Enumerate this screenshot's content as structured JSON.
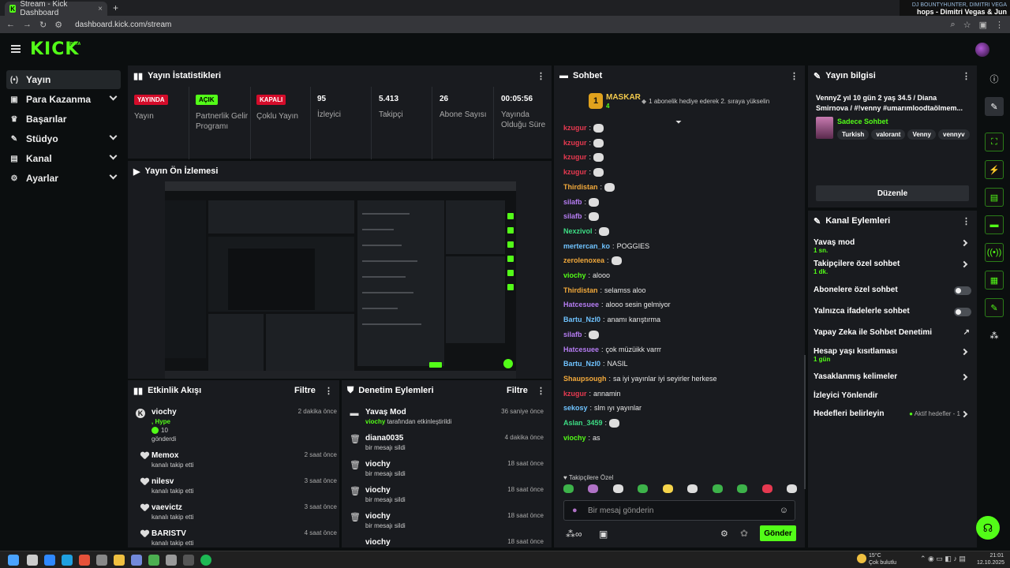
{
  "browser": {
    "tab_title": "Stream - Kick Dashboard",
    "new_tab": "+",
    "url": "dashboard.kick.com/stream",
    "media_title": "DJ BOUNTYHUNTER, DIMITRI VEGA",
    "media_song": "hops - Dimitri Vegas & Jun"
  },
  "app": {
    "logo": "KICK",
    "beta": "BETA"
  },
  "sidebar": {
    "items": [
      {
        "label": "Yayın",
        "icon": "(•)"
      },
      {
        "label": "Para Kazanma",
        "icon": "▣"
      },
      {
        "label": "Başarılar",
        "icon": "♛"
      },
      {
        "label": "Stüdyo",
        "icon": "✎"
      },
      {
        "label": "Kanal",
        "icon": "▤"
      },
      {
        "label": "Ayarlar",
        "icon": "⚙"
      }
    ]
  },
  "stats": {
    "title": "Yayın İstatistikleri",
    "cols": [
      {
        "badge": "YAYINDA",
        "label": "Yayın"
      },
      {
        "badge": "AÇIK",
        "label": "Partnerlik Gelir Programı"
      },
      {
        "badge": "KAPALI",
        "label": "Çoklu Yayın"
      },
      {
        "value": "95",
        "label": "İzleyici"
      },
      {
        "value": "5.413",
        "label": "Takipçi"
      },
      {
        "value": "26",
        "label": "Abone Sayısı"
      },
      {
        "value": "00:05:56",
        "label": "Yayında Olduğu Süre"
      }
    ]
  },
  "preview": {
    "title": "Yayın Ön İzlemesi"
  },
  "activity": {
    "title": "Etkinlik Akışı",
    "filter": "Filtre",
    "rows": [
      {
        "name": "viochy",
        "time": "2 dakika önce",
        "line1": ", Hype",
        "line2": "10",
        "line3": "gönderdi"
      },
      {
        "name": "Memox",
        "sub": "kanalı takip etti",
        "time": "2 saat önce"
      },
      {
        "name": "nilesv",
        "sub": "kanalı takip etti",
        "time": "3 saat önce"
      },
      {
        "name": "vaevictz",
        "sub": "kanalı takip etti",
        "time": "3 saat önce"
      },
      {
        "name": "BARISTV",
        "sub": "kanalı takip etti",
        "time": "4 saat önce"
      }
    ]
  },
  "moderation": {
    "title": "Denetim Eylemleri",
    "filter": "Filtre",
    "rows": [
      {
        "name": "Yavaş Mod",
        "user": "viochy",
        "sub": "tarafından etkinleştirildi",
        "time": "36 saniye önce"
      },
      {
        "name": "diana0035",
        "sub": "bir mesajı sildi",
        "time": "4 dakika önce"
      },
      {
        "name": "viochy",
        "sub": "bir mesajı sildi",
        "time": "18 saat önce"
      },
      {
        "name": "viochy",
        "sub": "bir mesajı sildi",
        "time": "18 saat önce"
      },
      {
        "name": "viochy",
        "sub": "bir mesajı sildi",
        "time": "18 saat önce"
      },
      {
        "name": "viochy",
        "sub": "",
        "time": "18 saat önce"
      }
    ]
  },
  "chat": {
    "title": "Sohbet",
    "pinned_user": "MASKAR",
    "pinned_rank": "1",
    "pinned_count": "4",
    "pinned_text": "1 abonelik hediye ederek 2. sıraya yükselin",
    "messages": [
      {
        "user": "kzugur",
        "color": "#e63950",
        "text": ""
      },
      {
        "user": "kzugur",
        "color": "#e63950",
        "text": ""
      },
      {
        "user": "kzugur",
        "color": "#e63950",
        "text": ""
      },
      {
        "user": "kzugur",
        "color": "#e63950",
        "text": ""
      },
      {
        "user": "Thirdistan",
        "color": "#f2a93b",
        "text": ""
      },
      {
        "user": "silafb",
        "color": "#b57cf2",
        "text": ""
      },
      {
        "user": "silafb",
        "color": "#b57cf2",
        "text": ""
      },
      {
        "user": "Nexzivol",
        "color": "#3ddc84",
        "text": ""
      },
      {
        "user": "mertercan_ko",
        "color": "#6fc3ff",
        "text": "POGGIES"
      },
      {
        "user": "zerolenoxea",
        "color": "#f2a93b",
        "text": ""
      },
      {
        "user": "viochy",
        "color": "#53fc18",
        "text": "alooo"
      },
      {
        "user": "Thirdistan",
        "color": "#f2a93b",
        "text": "selamss aloo"
      },
      {
        "user": "Hatcesuee",
        "color": "#b57cf2",
        "text": "alooo sesin gelmiyor"
      },
      {
        "user": "Bartu_NzI0",
        "color": "#6fc3ff",
        "text": "anamı karıştırma"
      },
      {
        "user": "silafb",
        "color": "#b57cf2",
        "text": ""
      },
      {
        "user": "Hatcesuee",
        "color": "#b57cf2",
        "text": "çok müzüikk varrr"
      },
      {
        "user": "Bartu_NzI0",
        "color": "#6fc3ff",
        "text": "NASIL"
      },
      {
        "user": "Shaupsough",
        "color": "#f2a93b",
        "text": "sa iyi yayınlar iyi seyirler herkese"
      },
      {
        "user": "kzugur",
        "color": "#e63950",
        "text": "annamin"
      },
      {
        "user": "sekosy",
        "color": "#6fc3ff",
        "text": "slm ıyı yayınlar"
      },
      {
        "user": "Aslan_3459",
        "color": "#3ddc84",
        "text": ""
      },
      {
        "user": "viochy",
        "color": "#53fc18",
        "text": "as"
      }
    ],
    "emote_bar_label": "Takipçilere Özel",
    "input_placeholder": "Bir mesaj gönderin",
    "send": "Gönder"
  },
  "stream_info": {
    "title": "Yayın bilgisi",
    "text": "VennyZ yıl 10 gün 2 yaş 34.5 / Diana Smirnova / #!venny #umarımloodtaölmem...",
    "category": "Sadece Sohbet",
    "tags": [
      "Turkish",
      "valorant",
      "Venny",
      "vennyv"
    ],
    "edit": "Düzenle"
  },
  "channel_actions": {
    "title": "Kanal Eylemleri",
    "items": [
      {
        "label": "Yavaş mod",
        "sub": "1 sn.",
        "kind": "arrow"
      },
      {
        "label": "Takipçilere özel sohbet",
        "sub": "1 dk.",
        "kind": "arrow"
      },
      {
        "label": "Abonelere özel sohbet",
        "sub": "",
        "kind": "toggle"
      },
      {
        "label": "Yalnızca ifadelerle sohbet",
        "sub": "",
        "kind": "toggle"
      },
      {
        "label": "Yapay Zeka ile Sohbet Denetimi",
        "sub": "",
        "kind": "external"
      },
      {
        "label": "Hesap yaşı kısıtlaması",
        "sub": "1 gün",
        "kind": "arrow"
      },
      {
        "label": "Yasaklanmış kelimeler",
        "sub": "",
        "kind": "arrow"
      },
      {
        "label": "İzleyici Yönlendir",
        "sub": "",
        "kind": "none"
      },
      {
        "label": "Hedefleri belirleyin",
        "sub": "",
        "kind": "arrow",
        "right": "Aktif hedefler - 1"
      }
    ]
  },
  "taskbar": {
    "weather_temp": "15°C",
    "weather_desc": "Çok bulutlu",
    "time": "21:01",
    "date": "12.10.2025"
  }
}
